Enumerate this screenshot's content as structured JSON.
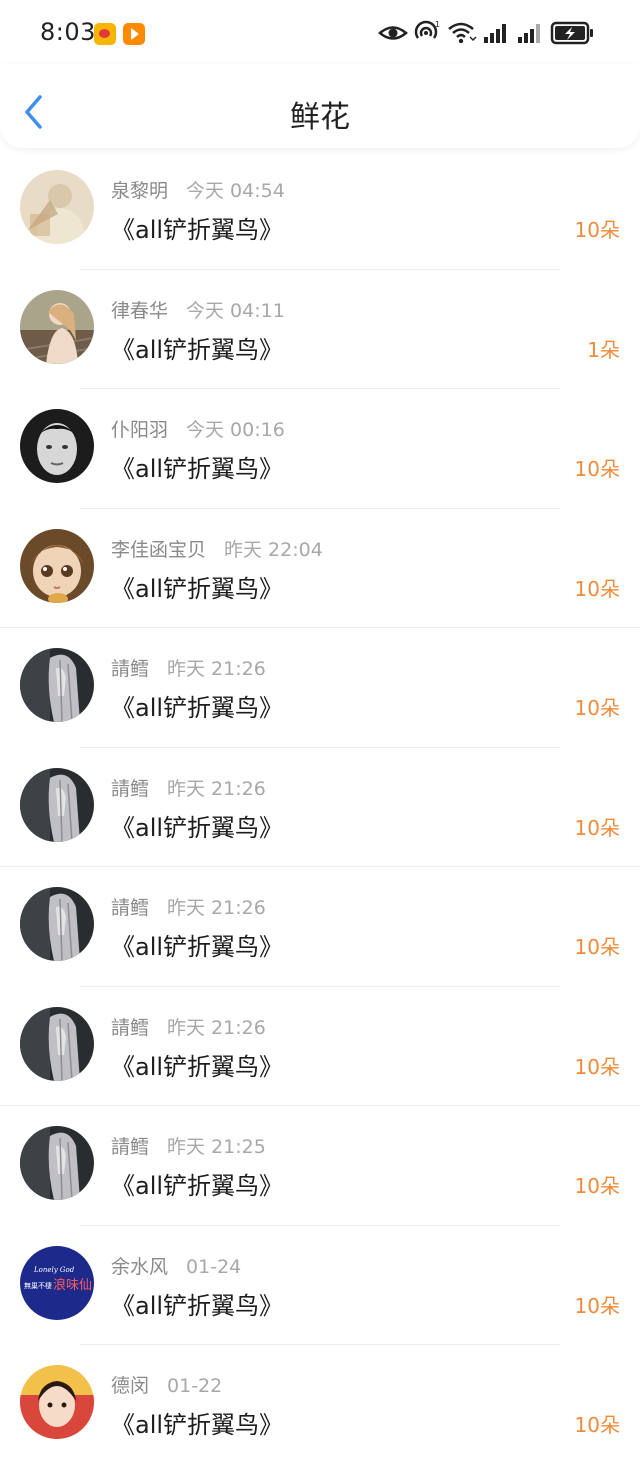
{
  "status_bar": {
    "time": "8:03",
    "apps": [
      "weibo-icon",
      "video-app-icon"
    ],
    "icons": [
      "eye-icon",
      "hotspot-icon",
      "wifi-icon",
      "signal-icon",
      "signal-icon",
      "battery-icon"
    ]
  },
  "header": {
    "title": "鲜花",
    "back_icon": "chevron-left-icon"
  },
  "colors": {
    "accent_blue": "#3b8ff0",
    "count_orange": "#f08a3a",
    "name_gray": "#8a8a8a",
    "time_gray": "#a8a8a8"
  },
  "records": [
    {
      "name": "泉黎明",
      "time": "今天 04:54",
      "book": "《all铲折翼鸟》",
      "count": "10朵",
      "avatar": "beige-photo"
    },
    {
      "name": "律春华",
      "time": "今天 04:11",
      "book": "《all铲折翼鸟》",
      "count": "1朵",
      "avatar": "railway-photo"
    },
    {
      "name": "仆阳羽",
      "time": "今天 00:16",
      "book": "《all铲折翼鸟》",
      "count": "10朵",
      "avatar": "bw-face-photo"
    },
    {
      "name": "李佳函宝贝",
      "time": "昨天 22:04",
      "book": "《all铲折翼鸟》",
      "count": "10朵",
      "avatar": "doll-photo"
    },
    {
      "name": "請鳕",
      "time": "昨天 21:26",
      "book": "《all铲折翼鸟》",
      "count": "10朵",
      "avatar": "gray-hair-photo"
    },
    {
      "name": "請鳕",
      "time": "昨天 21:26",
      "book": "《all铲折翼鸟》",
      "count": "10朵",
      "avatar": "gray-hair-photo"
    },
    {
      "name": "請鳕",
      "time": "昨天 21:26",
      "book": "《all铲折翼鸟》",
      "count": "10朵",
      "avatar": "gray-hair-photo"
    },
    {
      "name": "請鳕",
      "time": "昨天 21:26",
      "book": "《all铲折翼鸟》",
      "count": "10朵",
      "avatar": "gray-hair-photo"
    },
    {
      "name": "請鳕",
      "time": "昨天 21:25",
      "book": "《all铲折翼鸟》",
      "count": "10朵",
      "avatar": "gray-hair-photo"
    },
    {
      "name": "余水风",
      "time": "01-24",
      "book": "《all铲折翼鸟》",
      "count": "10朵",
      "avatar": "blue-logo",
      "avatar_text": {
        "top": "Lonely God",
        "left": "無巢不棲",
        "main": "浪味仙"
      }
    },
    {
      "name": "德闵",
      "time": "01-22",
      "book": "《all铲折翼鸟》",
      "count": "10朵",
      "avatar": "child-photo"
    }
  ]
}
